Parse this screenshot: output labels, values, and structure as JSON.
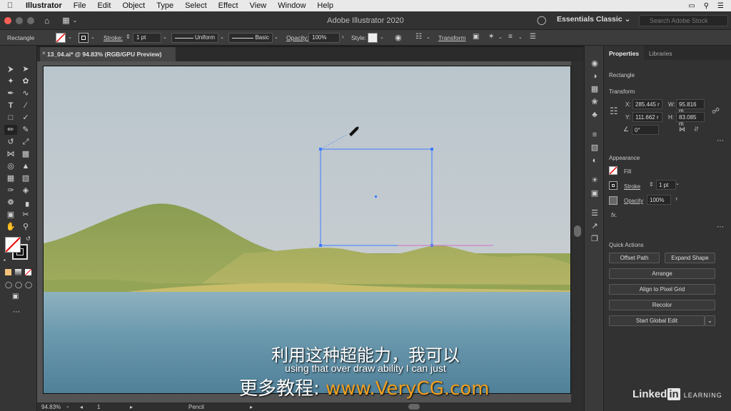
{
  "menubar": {
    "app": "Illustrator",
    "items": [
      "File",
      "Edit",
      "Object",
      "Type",
      "Select",
      "Effect",
      "View",
      "Window",
      "Help"
    ]
  },
  "appbar": {
    "title": "Adobe Illustrator 2020",
    "workspace": "Essentials Classic",
    "search_placeholder": "Search Adobe Stock"
  },
  "controlbar": {
    "object_type": "Rectangle",
    "stroke_label": "Stroke:",
    "stroke_value": "1 pt",
    "profile": "Uniform",
    "brush": "Basic",
    "opacity_label": "Opacity:",
    "opacity_value": "100%",
    "style_label": "Style:",
    "transform_label": "Transform"
  },
  "document": {
    "tab_title": "13_04.ai* @ 94.83% (RGB/GPU Preview)"
  },
  "status": {
    "zoom": "94.83%",
    "artboard": "1",
    "tool": "Pencil"
  },
  "properties": {
    "tabs": [
      "Properties",
      "Libraries"
    ],
    "object_type": "Rectangle",
    "transform_title": "Transform",
    "x_label": "X:",
    "x_value": "285.445 r",
    "y_label": "Y:",
    "y_value": "111.662 r",
    "w_label": "W:",
    "w_value": "95.816 m",
    "h_label": "H:",
    "h_value": "83.085 m",
    "rotate_value": "0°",
    "appearance_title": "Appearance",
    "fill_label": "Fill",
    "stroke_label": "Stroke",
    "stroke_value": "1 pt",
    "opacity_label": "Opacity",
    "opacity_value": "100%",
    "fx_label": "fx.",
    "quick_actions_title": "Quick Actions",
    "offset_path": "Offset Path",
    "expand_shape": "Expand Shape",
    "arrange": "Arrange",
    "align_pixel": "Align to Pixel Grid",
    "recolor": "Recolor",
    "global_edit": "Start Global Edit"
  },
  "subtitles": {
    "line1": "利用这种超能力，我可以",
    "line2": "using that over draw ability I can just",
    "line3_prefix": "更多教程: ",
    "line3_url": "www.VeryCG.com"
  },
  "watermark": {
    "linked": "Linked",
    "in": "in",
    "learning": "LEARNING"
  },
  "colors": {
    "selection": "#3d7bff",
    "sky_top": "#a9b6bf",
    "water": "#5a8ba3",
    "hill": "#8e9f56"
  }
}
